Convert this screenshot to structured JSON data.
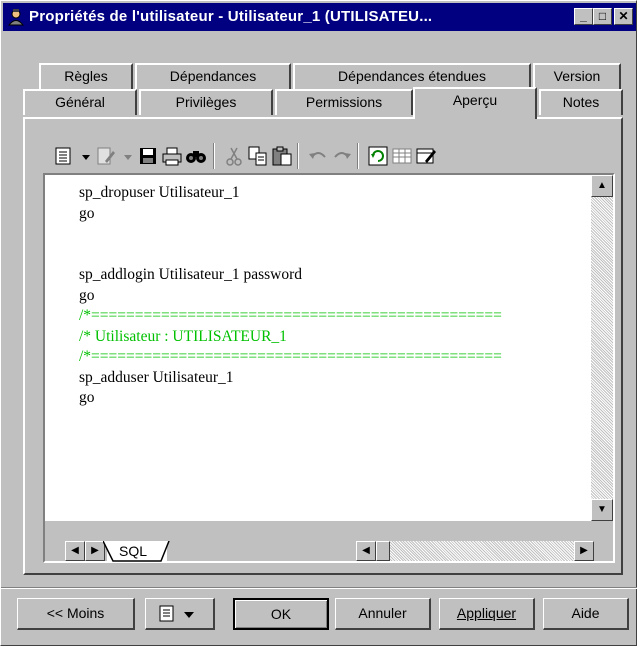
{
  "window": {
    "title": "Propriétés de l'utilisateur - Utilisateur_1 (UTILISATEU...",
    "controls": {
      "minimize": "_",
      "maximize": "□",
      "close": "✕"
    }
  },
  "tabs": {
    "row1": [
      "Règles",
      "Dépendances",
      "Dépendances étendues",
      "Version"
    ],
    "row2": [
      "Général",
      "Privilèges",
      "Permissions",
      "Aperçu",
      "Notes"
    ],
    "active": "Aperçu"
  },
  "toolbar": {
    "icons": [
      "properties-icon",
      "dropdown-arrow-icon",
      "edit-icon",
      "dropdown-arrow-icon",
      "save-icon",
      "print-icon",
      "find-icon",
      "cut-icon",
      "copy-icon",
      "paste-icon",
      "undo-icon",
      "redo-icon",
      "refresh-icon",
      "table-icon",
      "edit-table-icon"
    ]
  },
  "code": {
    "lines": [
      {
        "text": "sp_dropuser Utilisateur_1",
        "type": "normal"
      },
      {
        "text": "go",
        "type": "normal"
      },
      {
        "text": "",
        "type": "normal"
      },
      {
        "text": "",
        "type": "normal"
      },
      {
        "text": "sp_addlogin Utilisateur_1 password",
        "type": "normal"
      },
      {
        "text": "go",
        "type": "normal"
      },
      {
        "text": "/*===============================================",
        "type": "comment"
      },
      {
        "text": "/* Utilisateur : UTILISATEUR_1",
        "type": "comment"
      },
      {
        "text": "/*===============================================",
        "type": "comment"
      },
      {
        "text": "sp_adduser Utilisateur_1",
        "type": "normal"
      },
      {
        "text": "go",
        "type": "normal"
      }
    ]
  },
  "sheet_tab": {
    "label": "SQL"
  },
  "buttons": {
    "less": "<< Moins",
    "ok": "OK",
    "cancel": "Annuler",
    "apply": "Appliquer",
    "help": "Aide"
  },
  "colors": {
    "titlebar": "#000080",
    "comment": "#00c000",
    "face": "#c0c0c0"
  }
}
